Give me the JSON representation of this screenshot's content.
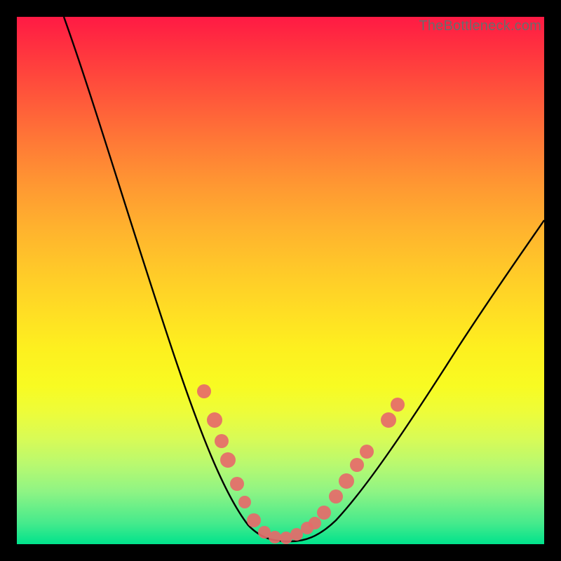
{
  "watermark": "TheBottleneck.com",
  "chart_data": {
    "type": "line",
    "title": "",
    "xlabel": "",
    "ylabel": "",
    "xlim": [
      0,
      100
    ],
    "ylim": [
      0,
      100
    ],
    "grid": false,
    "legend": false,
    "series": [
      {
        "name": "bottleneck-curve",
        "x": [
          9,
          12,
          16,
          20,
          24,
          28,
          32,
          35,
          38,
          40,
          42,
          44,
          46,
          48,
          50,
          52,
          54,
          56,
          58,
          62,
          66,
          70,
          74,
          78,
          82,
          86,
          90,
          94,
          98,
          100
        ],
        "y": [
          100,
          92,
          82,
          71,
          60,
          49,
          38,
          29,
          22,
          16,
          11,
          7,
          4,
          2,
          1,
          1,
          2,
          3,
          5,
          10,
          16,
          22,
          28,
          34,
          40,
          46,
          52,
          58,
          63,
          65
        ]
      }
    ],
    "markers": {
      "name": "highlight-points",
      "points": [
        {
          "x": 35.5,
          "y": 29
        },
        {
          "x": 37.5,
          "y": 23.5
        },
        {
          "x": 38.8,
          "y": 19.5
        },
        {
          "x": 40.0,
          "y": 16
        },
        {
          "x": 41.8,
          "y": 11.5
        },
        {
          "x": 43.2,
          "y": 8
        },
        {
          "x": 45.0,
          "y": 4.5
        },
        {
          "x": 47.0,
          "y": 2.3
        },
        {
          "x": 49.0,
          "y": 1.3
        },
        {
          "x": 51.0,
          "y": 1.2
        },
        {
          "x": 53.0,
          "y": 1.8
        },
        {
          "x": 55.0,
          "y": 3.0
        },
        {
          "x": 56.5,
          "y": 4.0
        },
        {
          "x": 58.2,
          "y": 6.0
        },
        {
          "x": 60.5,
          "y": 9.0
        },
        {
          "x": 62.5,
          "y": 12.0
        },
        {
          "x": 64.5,
          "y": 15.0
        },
        {
          "x": 66.3,
          "y": 17.5
        },
        {
          "x": 70.5,
          "y": 23.5
        },
        {
          "x": 72.2,
          "y": 26.5
        }
      ]
    },
    "gradient_stops": [
      {
        "pos": 0,
        "color": "#ff1a44"
      },
      {
        "pos": 50,
        "color": "#ffd928"
      },
      {
        "pos": 78,
        "color": "#f4fb2e"
      },
      {
        "pos": 100,
        "color": "#00e38c"
      }
    ]
  }
}
